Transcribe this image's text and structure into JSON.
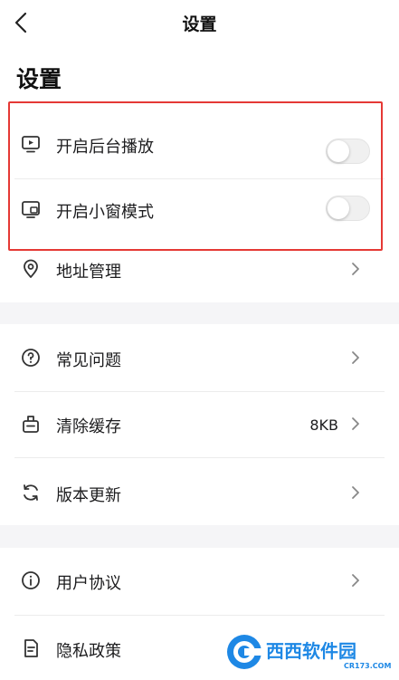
{
  "navbar": {
    "title": "设置",
    "back_icon": "chevron-left-icon"
  },
  "page_title": "设置",
  "section_media": {
    "items": [
      {
        "icon": "play-screen-icon",
        "label": "开启后台播放",
        "toggle_on": false
      },
      {
        "icon": "picture-in-picture-icon",
        "label": "开启小窗模式",
        "toggle_on": false
      }
    ]
  },
  "address": {
    "icon": "location-pin-icon",
    "label": "地址管理"
  },
  "section_support": {
    "items": [
      {
        "icon": "question-circle-icon",
        "label": "常见问题",
        "value": ""
      },
      {
        "icon": "clean-bag-icon",
        "label": "清除缓存",
        "value": "8KB"
      },
      {
        "icon": "refresh-icon",
        "label": "版本更新",
        "value": ""
      }
    ]
  },
  "section_legal": {
    "items": [
      {
        "icon": "info-circle-icon",
        "label": "用户协议"
      },
      {
        "icon": "document-icon",
        "label": "隐私政策"
      }
    ]
  },
  "watermark": {
    "brand": "西西软件园",
    "domain": "CR173.COM"
  },
  "colors": {
    "highlight": "#e53935",
    "section_gap": "#f5f5f7",
    "watermark_blue": "#1e88e5"
  }
}
